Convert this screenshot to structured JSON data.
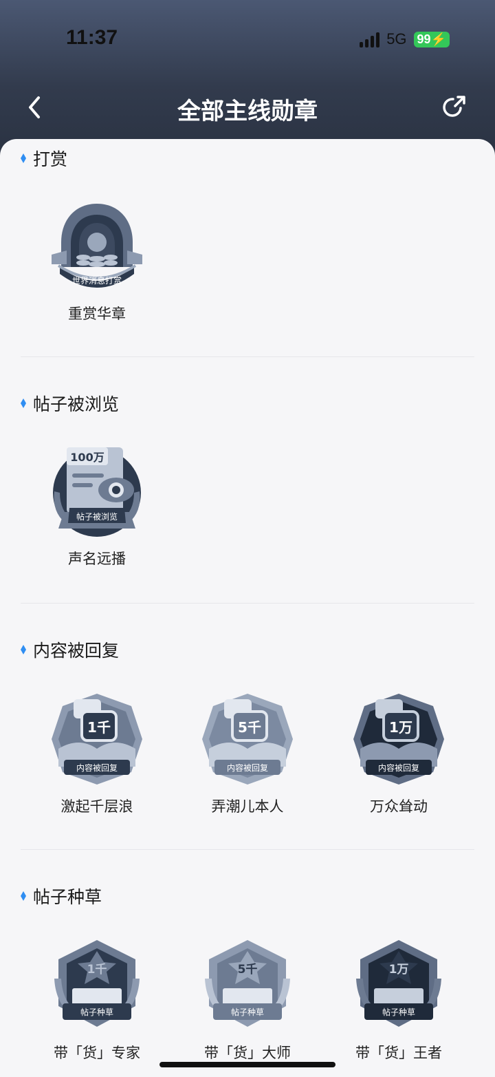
{
  "status_bar": {
    "time": "11:37",
    "network": "5G",
    "battery": "99"
  },
  "nav": {
    "title": "全部主线勋章",
    "back_icon": "chevron-left-icon",
    "share_icon": "share-icon"
  },
  "sections": [
    {
      "title": "打赏",
      "badges": [
        {
          "name": "重赏华章",
          "emblem": "世界消息打赏"
        }
      ]
    },
    {
      "title": "帖子被浏览",
      "badges": [
        {
          "name": "声名远播",
          "emblem": "帖子被浏览",
          "count": "100万"
        }
      ]
    },
    {
      "title": "内容被回复",
      "badges": [
        {
          "name": "激起千层浪",
          "emblem": "内容被回复",
          "count": "1千"
        },
        {
          "name": "弄潮儿本人",
          "emblem": "内容被回复",
          "count": "5千"
        },
        {
          "name": "万众耸动",
          "emblem": "内容被回复",
          "count": "1万"
        }
      ]
    },
    {
      "title": "帖子种草",
      "badges": [
        {
          "name": "带「货」专家",
          "emblem": "帖子种草",
          "count": "1千"
        },
        {
          "name": "带「货」大师",
          "emblem": "帖子种草",
          "count": "5千"
        },
        {
          "name": "带「货」王者",
          "emblem": "帖子种草",
          "count": "1万"
        }
      ]
    }
  ],
  "colors": {
    "accent": "#2f8ef2",
    "badge_light": "#9aa7bb",
    "badge_mid": "#6d7b92",
    "badge_dark": "#2d3a4e"
  }
}
